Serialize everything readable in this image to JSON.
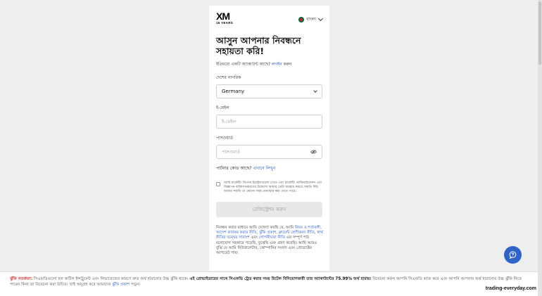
{
  "brand": {
    "logo_main": "XM",
    "logo_sub": "15 YEARS"
  },
  "language": {
    "label": "বাংলা"
  },
  "form": {
    "heading": "আসুন আপনার নিবন্ধনে সহায়তা করি!",
    "login_prompt": "ইতিমধ্যে একটি অ্যাকাউন্ট আছে?",
    "login_link": "লগইন",
    "login_suffix": "করুন",
    "country": {
      "label": "দেশের নাগরিক",
      "value": "Germany"
    },
    "email": {
      "label": "ই-মেইল",
      "placeholder": "ই-মেইল",
      "value": ""
    },
    "password": {
      "label": "পাসওয়ার্ড",
      "placeholder": "পাসওয়ার্ড",
      "value": ""
    },
    "partner_prompt": "পার্টনার কোড আছে?",
    "partner_link": "এখানে লিখুন",
    "consent_text": "আমি মার্কেটিং বিপণন ইমেইলগুলো পেতে এবং মার্কেটিং অপ্টিমাইজেশন এবং বিজ্ঞাপন ব্যক্তিগতকরণের উদ্দেশ্যে আমার ডেটা ব্যবহার করতে সম্মতি দিই। আমার সম্মতি যে কোনো সময় প্রত্যাহার করা যেতে পারে।",
    "register_label": "রেজিস্ট্রেশন করুন",
    "legal": {
      "p1": "নিবন্ধন করার মাধ্যমে আমি ঘোষণা করছি যে, আমি ",
      "l1": "নিয়ম ও শর্তাবলী",
      "p2": ", ",
      "l2": "আদেশ কার্যকর করার নীতি",
      "p3": ", ",
      "l3": "ঝুঁকি প্রকাশ",
      "p4": ", ",
      "l4": "ক্লায়েন্ট শ্রেণীকরণ নীতি",
      "p5": ", ",
      "l5": "স্বার্থ নীতির দ্বন্দ্বের সারাংশ",
      "p6": " এবং ",
      "l6": "গোপনীয়তা নীতি",
      "p7": " এর সম্পূর্ণ পাঠ মনোযোগ সহকারে পড়েছি, বুঝেছি এবং গ্রহণ করেছি। আমি আরও বুঝি যে আমি নিউজলেটার, কোম্পানির সংবাদ এবং প্রোডাক্টের আপডেট পাব।"
    }
  },
  "risk_banner": {
    "warning_label": "ঝুঁকি সতর্কতা:",
    "text1": " সিএফডিগুলো হল জটিল ইন্সট্রুমেন্ট এবং লিভারেজের কারণে দ্রুত অর্থ হারানোর উচ্চ ঝুঁকি থাকে। ",
    "bold_text": "এই প্রোভাইডারের সাথে সিএফডি ট্রেড করার সময় রিটেল বিনিয়োগকারী তার অ্যাকাউন্টের 75.99% অর্থ হারায়।",
    "text2": " বিবেচনা করুন আপনি সিএফডি কাজ করে এবং আপনি আপনার অর্থ হারানোর উচ্চ ঝুঁকি নিতে পারেন কিনা তা বিবেচনা করা উচিত। তাই অনুগ্রহ করে আমাদের ",
    "link": "ঝুঁকি প্রকাশ",
    "text3": " পড়ুন।"
  },
  "watermark": "trading-everyday.com",
  "icons": {
    "chat": "chat-bubble-icon",
    "eye": "eye-off-icon",
    "dropdown": "chevron-down-icon"
  },
  "colors": {
    "link": "#1c4fbf",
    "chat_button": "#2f63c7",
    "warning": "#c9302c"
  }
}
